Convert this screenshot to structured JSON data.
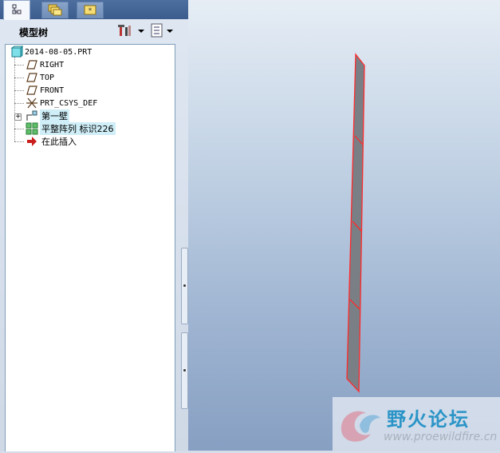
{
  "tabs": [
    {
      "name": "model-tree-tab",
      "icon": "tree-structure-icon",
      "active": true
    },
    {
      "name": "folder-browser-tab",
      "icon": "folders-icon",
      "active": false
    },
    {
      "name": "favorites-tab",
      "icon": "favorites-folder-icon",
      "active": false
    }
  ],
  "model_tree": {
    "title": "模型树",
    "settings_icon": "tools-icon",
    "display_icon": "list-settings-icon",
    "items": [
      {
        "label": "2014-08-05.PRT",
        "icon": "part-icon"
      },
      {
        "label": "RIGHT",
        "icon": "datum-plane-icon"
      },
      {
        "label": "TOP",
        "icon": "datum-plane-icon"
      },
      {
        "label": "FRONT",
        "icon": "datum-plane-icon"
      },
      {
        "label": "PRT_CSYS_DEF",
        "icon": "coordinate-system-icon"
      },
      {
        "label": "第一壁",
        "icon": "first-wall-icon"
      },
      {
        "label": "平整阵列 标识226",
        "icon": "pattern-icon"
      },
      {
        "label": "在此插入",
        "icon": "insert-here-arrow-icon"
      }
    ]
  },
  "watermark": {
    "text": "野火论坛",
    "url": "www.proewildfire.cn",
    "icon": "wildfire-logo-icon"
  },
  "colors": {
    "edge_highlight": "#ff2a2a",
    "part_fill": "#7a7f86",
    "selection": "#cfeef7"
  }
}
